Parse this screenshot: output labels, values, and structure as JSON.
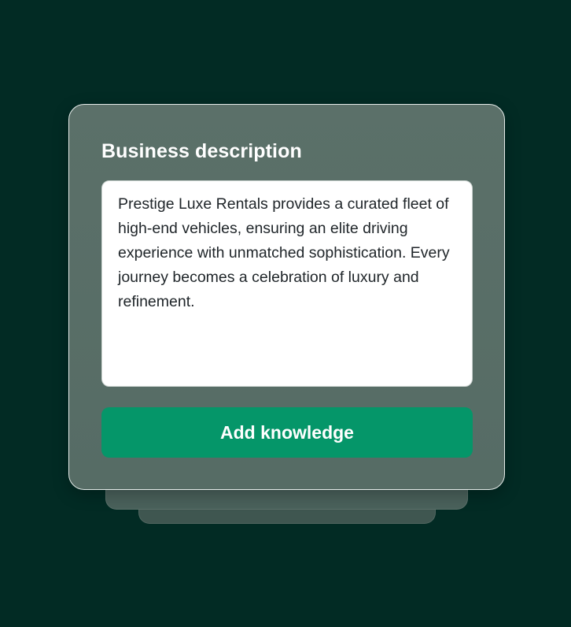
{
  "card": {
    "title": "Business description",
    "description": "Prestige Luxe Rentals provides a curated fleet of high-end vehicles, ensuring an elite driving experience with unmatched sophistication. Every journey becomes a celebration of luxury and refinement.",
    "button_label": "Add knowledge"
  },
  "colors": {
    "background": "#022b24",
    "card": "#586d66",
    "button": "#059669",
    "text_field": "#ffffff"
  }
}
